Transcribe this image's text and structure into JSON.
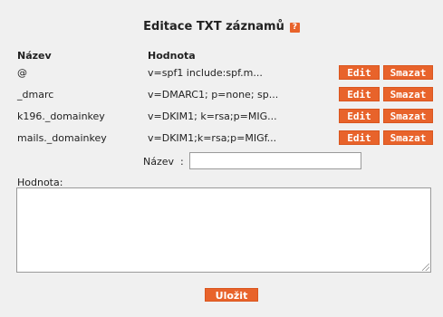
{
  "title": "Editace TXT záznamů",
  "help_icon": "?",
  "columns": {
    "name": "Název",
    "value": "Hodnota"
  },
  "records": [
    {
      "name": "@",
      "value": "v=spf1 include:spf.m...",
      "edit": "Edit",
      "delete": "Smazat"
    },
    {
      "name": "_dmarc",
      "value": "v=DMARC1; p=none; sp...",
      "edit": "Edit",
      "delete": "Smazat"
    },
    {
      "name": "k196._domainkey",
      "value": "v=DKIM1; k=rsa;p=MIG...",
      "edit": "Edit",
      "delete": "Smazat"
    },
    {
      "name": "mails._domainkey",
      "value": "v=DKIM1;k=rsa;p=MIGf...",
      "edit": "Edit",
      "delete": "Smazat"
    }
  ],
  "form": {
    "name_label": "Název  :",
    "name_value": "",
    "value_label": "Hodnota:",
    "value_text": "",
    "save_label": "Uložit"
  },
  "colors": {
    "accent": "#e8632b",
    "background": "#f0f0f0"
  }
}
